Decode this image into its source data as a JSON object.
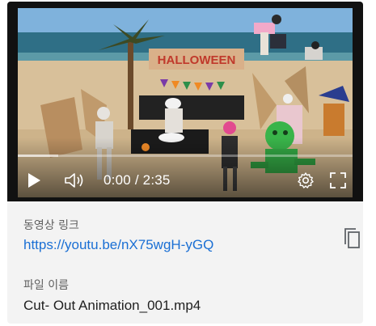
{
  "player": {
    "current_time": "0:00",
    "separator": " / ",
    "duration": "2:35",
    "buffered_fraction": 0.12,
    "icons": {
      "play": "play-icon",
      "volume": "volume-icon",
      "settings": "gear-icon",
      "fullscreen": "fullscreen-icon"
    },
    "scene_sign_text": "HALLOWEEN"
  },
  "share": {
    "link_label": "동영상 링크",
    "link_url": "https://youtu.be/nX75wgH-yGQ",
    "copy_icon": "copy-icon",
    "file_label": "파일 이름",
    "file_name": "Cut- Out Animation_001.mp4"
  },
  "colors": {
    "link": "#1a6fd4",
    "card_background": "#f3f3f3",
    "player_background": "#111111"
  }
}
